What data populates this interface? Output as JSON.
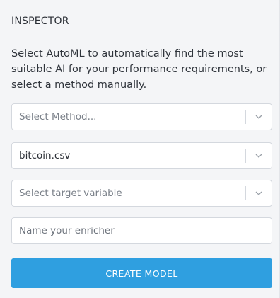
{
  "inspector": {
    "title": "INSPECTOR",
    "description": "Select AutoML to automatically find the most suitable AI for your performance requirements, or select a method manually.",
    "method_select": {
      "placeholder": "Select Method..."
    },
    "dataset_select": {
      "value": "bitcoin.csv"
    },
    "target_select": {
      "placeholder": "Select target variable"
    },
    "enricher_name": {
      "placeholder": "Name your enricher",
      "value": ""
    },
    "create_button": {
      "label": "CREATE MODEL"
    },
    "icons": {
      "dropdown": "chevron-down-icon"
    },
    "colors": {
      "accent": "#2f9fe0",
      "panel_bg": "#f4f5f7",
      "border": "#d4d8de"
    }
  }
}
